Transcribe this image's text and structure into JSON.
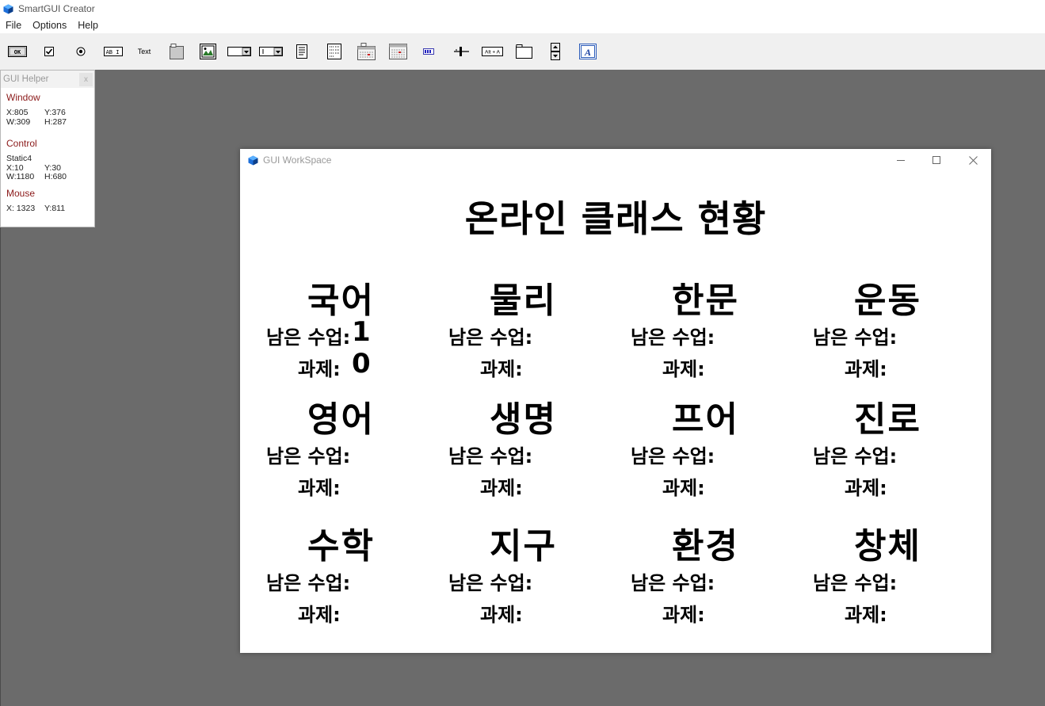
{
  "app": {
    "title": "SmartGUI Creator",
    "menu": [
      "File",
      "Options",
      "Help"
    ]
  },
  "toolbar": {
    "tools": [
      {
        "icon": "ok-button-icon",
        "label": "OK"
      },
      {
        "icon": "checkbox-icon"
      },
      {
        "icon": "radio-icon"
      },
      {
        "icon": "edit-icon",
        "label": "AB I"
      },
      {
        "icon": "text-icon",
        "label": "Text"
      },
      {
        "icon": "groupbox-icon"
      },
      {
        "icon": "picture-icon"
      },
      {
        "icon": "dropdown-icon"
      },
      {
        "icon": "combobox-icon"
      },
      {
        "icon": "listbox-icon"
      },
      {
        "icon": "listview-icon"
      },
      {
        "icon": "datetime-icon"
      },
      {
        "icon": "monthcal-icon"
      },
      {
        "icon": "progress-icon"
      },
      {
        "icon": "slider-icon"
      },
      {
        "icon": "hotkey-icon",
        "label": "Alt + A"
      },
      {
        "icon": "tab-icon"
      },
      {
        "icon": "updown-icon"
      },
      {
        "icon": "font-icon",
        "label": "A"
      }
    ]
  },
  "helper": {
    "title": "GUI Helper",
    "close": "x",
    "window_label": "Window",
    "window_x": "X:805",
    "window_y": "Y:376",
    "window_w": "W:309",
    "window_h": "H:287",
    "control_label": "Control",
    "control_name": "Static4",
    "control_x": "X:10",
    "control_y": "Y:30",
    "control_w": "W:1180",
    "control_h": "H:680",
    "mouse_label": "Mouse",
    "mouse_x": "X: 1323",
    "mouse_y": "Y:811"
  },
  "workspace": {
    "title": "GUI WorkSpace",
    "heading": "온라인 클래스 현황",
    "remaining_label": "남은 수업:",
    "assignment_label": "과제:",
    "subjects": [
      {
        "name": "국어",
        "remaining": "1",
        "assignment": "0"
      },
      {
        "name": "물리",
        "remaining": "",
        "assignment": ""
      },
      {
        "name": "한문",
        "remaining": "",
        "assignment": ""
      },
      {
        "name": "운동",
        "remaining": "",
        "assignment": ""
      },
      {
        "name": "영어",
        "remaining": "",
        "assignment": ""
      },
      {
        "name": "생명",
        "remaining": "",
        "assignment": ""
      },
      {
        "name": "프어",
        "remaining": "",
        "assignment": ""
      },
      {
        "name": "진로",
        "remaining": "",
        "assignment": ""
      },
      {
        "name": "수학",
        "remaining": "",
        "assignment": ""
      },
      {
        "name": "지구",
        "remaining": "",
        "assignment": ""
      },
      {
        "name": "환경",
        "remaining": "",
        "assignment": ""
      },
      {
        "name": "창체",
        "remaining": "",
        "assignment": ""
      }
    ]
  }
}
